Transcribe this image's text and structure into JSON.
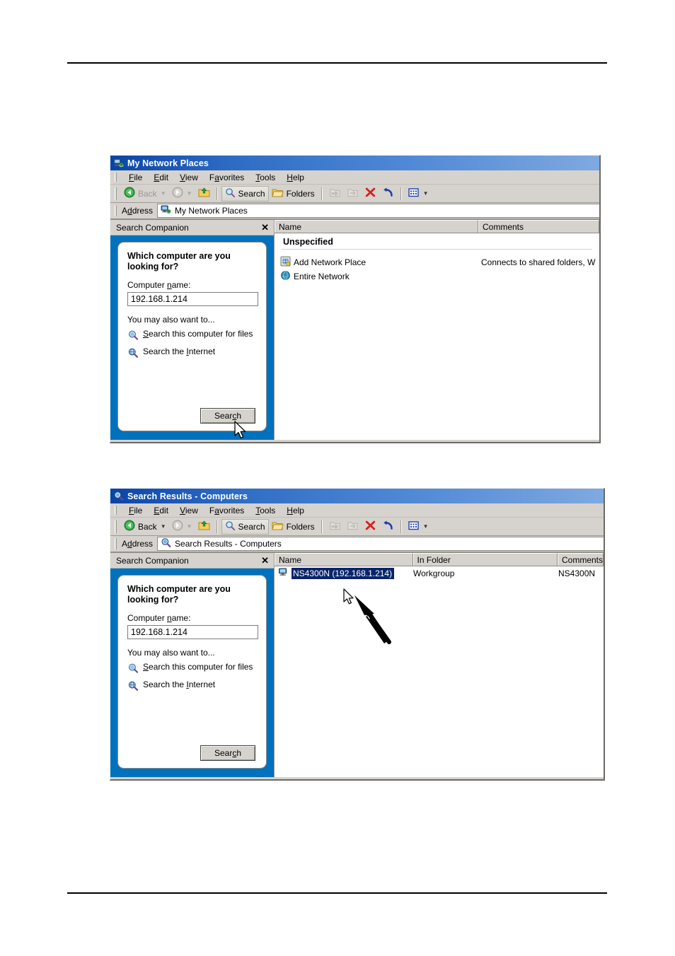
{
  "document": {
    "page_background": "#ffffff",
    "rule_color": "#000000"
  },
  "window1": {
    "title": "My Network Places",
    "title_icon": "network-places-icon",
    "menu": [
      {
        "label": "File",
        "accel": "F"
      },
      {
        "label": "Edit",
        "accel": "E"
      },
      {
        "label": "View",
        "accel": "V"
      },
      {
        "label": "Favorites",
        "accel": "a"
      },
      {
        "label": "Tools",
        "accel": "T"
      },
      {
        "label": "Help",
        "accel": "H"
      }
    ],
    "toolbar": {
      "back_label": "Back",
      "search_label": "Search",
      "folders_label": "Folders"
    },
    "address": {
      "label": "Address",
      "value": "My Network Places",
      "icon": "network-places-icon"
    },
    "search_companion": {
      "header": "Search Companion",
      "close": "✕",
      "question": "Which computer are you looking for?",
      "field_label_pre": "Computer ",
      "field_label_accel": "n",
      "field_label_post": "ame:",
      "computer_name_value": "192.168.1.214",
      "computer_name_placeholder": "",
      "also_text": "You may also want to...",
      "links": [
        {
          "icon": "search-files-icon",
          "pre": "",
          "accel": "S",
          "post": "earch this computer for files"
        },
        {
          "icon": "search-internet-icon",
          "pre": "Search the ",
          "accel": "I",
          "post": "nternet"
        }
      ],
      "button_pre": "Sear",
      "button_accel": "c",
      "button_post": "h"
    },
    "list": {
      "columns": [
        "Name",
        "Comments"
      ],
      "group_header": "Unspecified",
      "rows": [
        {
          "icon": "add-network-place-icon",
          "name": "Add Network Place",
          "comments": "Connects to shared folders, W"
        },
        {
          "icon": "entire-network-icon",
          "name": "Entire Network",
          "comments": ""
        }
      ]
    }
  },
  "window2": {
    "title": "Search Results - Computers",
    "title_icon": "search-results-icon",
    "menu": [
      {
        "label": "File",
        "accel": "F"
      },
      {
        "label": "Edit",
        "accel": "E"
      },
      {
        "label": "View",
        "accel": "V"
      },
      {
        "label": "Favorites",
        "accel": "a"
      },
      {
        "label": "Tools",
        "accel": "T"
      },
      {
        "label": "Help",
        "accel": "H"
      }
    ],
    "toolbar": {
      "back_label": "Back",
      "search_label": "Search",
      "folders_label": "Folders"
    },
    "address": {
      "label": "Address",
      "value": "Search Results - Computers",
      "icon": "search-results-icon"
    },
    "search_companion": {
      "header": "Search Companion",
      "close": "✕",
      "question": "Which computer are you looking for?",
      "field_label_pre": "Computer ",
      "field_label_accel": "n",
      "field_label_post": "ame:",
      "computer_name_value": "192.168.1.214",
      "computer_name_placeholder": "",
      "also_text": "You may also want to...",
      "links": [
        {
          "icon": "search-files-icon",
          "pre": "",
          "accel": "S",
          "post": "earch this computer for files"
        },
        {
          "icon": "search-internet-icon",
          "pre": "Search the ",
          "accel": "I",
          "post": "nternet"
        }
      ],
      "button_pre": "Sear",
      "button_accel": "c",
      "button_post": "h"
    },
    "list": {
      "columns": [
        "Name",
        "In Folder",
        "Comments"
      ],
      "rows": [
        {
          "icon": "computer-icon",
          "name": "NS4300N (192.168.1.214)",
          "in_folder": "Workgroup",
          "comments": "NS4300N",
          "selected": true
        }
      ]
    },
    "annotation": {
      "type": "callout-arrow",
      "color": "#000000"
    }
  },
  "colors": {
    "title_gradient_start": "#0a44a8",
    "title_gradient_end": "#7fa9e0",
    "companion_blue": "#0071bc",
    "selection_blue": "#0a246a",
    "chrome_gray": "#d6d3ce"
  }
}
